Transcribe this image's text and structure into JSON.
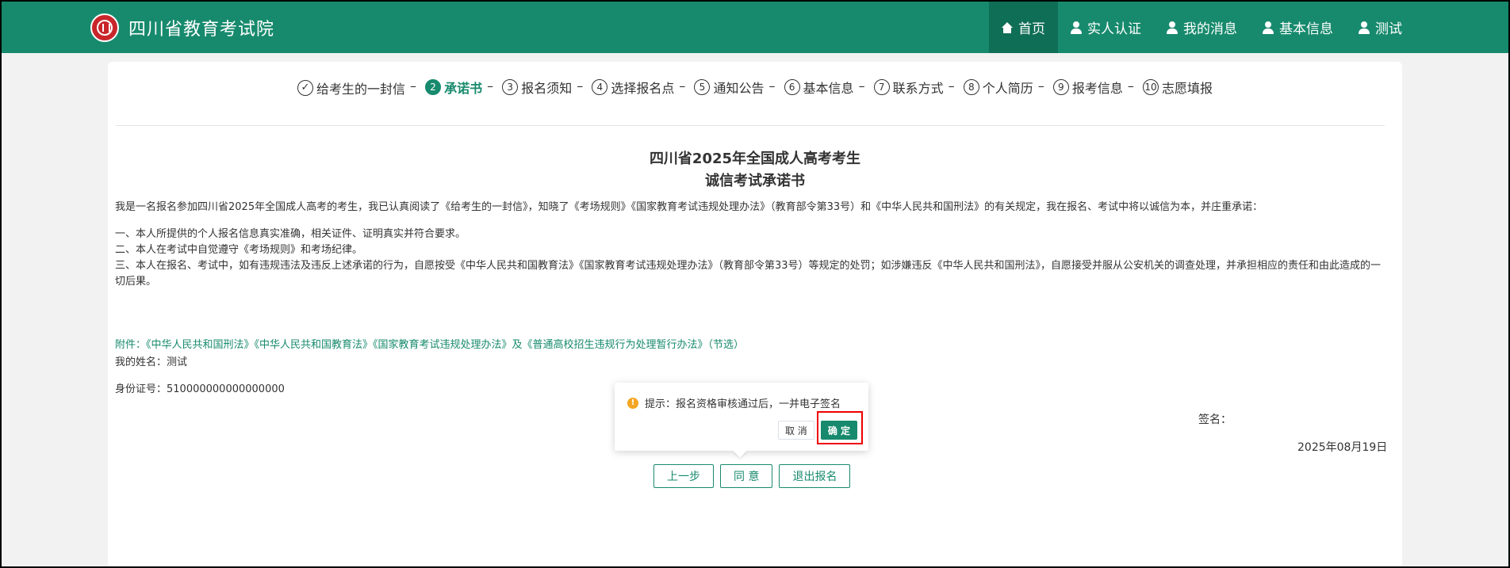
{
  "header": {
    "site_title": "四川省教育考试院",
    "nav": [
      {
        "label": "首页",
        "icon": "home-icon"
      },
      {
        "label": "实人认证",
        "icon": "user-icon"
      },
      {
        "label": "我的消息",
        "icon": "user-icon"
      },
      {
        "label": "基本信息",
        "icon": "user-icon"
      },
      {
        "label": "测试",
        "icon": "user-icon"
      }
    ]
  },
  "steps": [
    {
      "num": "✓",
      "label": "给考生的一封信",
      "state": "done"
    },
    {
      "num": "2",
      "label": "承诺书",
      "state": "active"
    },
    {
      "num": "3",
      "label": "报名须知",
      "state": "todo"
    },
    {
      "num": "4",
      "label": "选择报名点",
      "state": "todo"
    },
    {
      "num": "5",
      "label": "通知公告",
      "state": "todo"
    },
    {
      "num": "6",
      "label": "基本信息",
      "state": "todo"
    },
    {
      "num": "7",
      "label": "联系方式",
      "state": "todo"
    },
    {
      "num": "8",
      "label": "个人简历",
      "state": "todo"
    },
    {
      "num": "9",
      "label": "报考信息",
      "state": "todo"
    },
    {
      "num": "10",
      "label": "志愿填报",
      "state": "todo"
    }
  ],
  "document": {
    "title_line1": "四川省2025年全国成人高考考生",
    "title_line2": "诚信考试承诺书",
    "intro": "我是一名报名参加四川省2025年全国成人高考的考生，我已认真阅读了《给考生的一封信》，知晓了《考场规则》《国家教育考试违规处理办法》（教育部令第33号）和《中华人民共和国刑法》的有关规定，我在报名、考试中将以诚信为本，并庄重承诺：",
    "items": [
      "一、本人所提供的个人报名信息真实准确，相关证件、证明真实并符合要求。",
      "二、本人在考试中自觉遵守《考场规则》和考场纪律。",
      "三、本人在报名、考试中，如有违规违法及违反上述承诺的行为，自愿按受《中华人民共和国教育法》《国家教育考试违规处理办法》（教育部令第33号）等规定的处罚；如涉嫌违反《中华人民共和国刑法》，自愿接受并服从公安机关的调查处理，并承担相应的责任和由此造成的一切后果。"
    ],
    "attachment": "附件：《中华人民共和国刑法》《中华人民共和国教育法》《国家教育考试违规处理办法》及《普通高校招生违规行为处理暂行办法》（节选）",
    "name_line": "我的姓名：测试",
    "id_line": "身份证号：510000000000000000",
    "sign_label": "签名：",
    "date": "2025年08月19日"
  },
  "buttons": {
    "prev": "上一步",
    "agree": "同 意",
    "exit": "退出报名"
  },
  "popconfirm": {
    "message": "提示：报名资格审核通过后，一并电子签名",
    "cancel": "取 消",
    "confirm": "确 定"
  }
}
